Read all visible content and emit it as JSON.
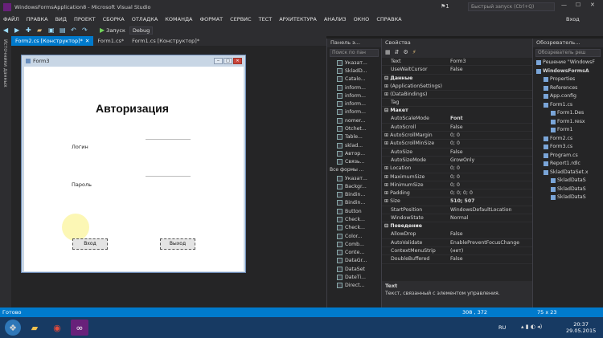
{
  "window": {
    "title": "WindowsFormsApplication8 - Microsoft Visual Studio",
    "quicklaunch_placeholder": "Быстрый запуск (Ctrl+Q)",
    "notif_count": "1",
    "user": "Вход"
  },
  "menu": [
    "ФАЙЛ",
    "ПРАВКА",
    "ВИД",
    "ПРОЕКТ",
    "СБОРКА",
    "ОТЛАДКА",
    "КОМАНДА",
    "ФОРМАТ",
    "СЕРВИС",
    "ТЕСТ",
    "АРХИТЕКТУРА",
    "АНАЛИЗ",
    "ОКНО",
    "СПРАВКА"
  ],
  "toolbar": {
    "run_label": "Запуск",
    "config": "Debug"
  },
  "left_tab": "Источники данных",
  "doc_tabs": [
    {
      "label": "Form2.cs [Конструктор]*",
      "active": true
    },
    {
      "label": "Form1.cs*",
      "active": false
    },
    {
      "label": "Form1.cs [Конструктор]*",
      "active": false
    }
  ],
  "form": {
    "title": "Form3",
    "heading": "Авторизация",
    "login_label": "Логин",
    "password_label": "Пароль",
    "enter_button": "Вход",
    "exit_button": "Выход"
  },
  "toolbox": {
    "title": "Панель э...",
    "search_placeholder": "Поиск по пан",
    "items_top": [
      "Указат...",
      "SkladD...",
      "Catalo...",
      "inform...",
      "inform...",
      "inform...",
      "inform...",
      "nomer...",
      "Otchet...",
      "Table...",
      "sklad...",
      "Автор...",
      "Связь..."
    ],
    "section": "Все формы ...",
    "items_bottom": [
      "Указат...",
      "Backgr...",
      "Bindin...",
      "Bindin...",
      "Button",
      "Check...",
      "Check...",
      "Color...",
      "Comb...",
      "Conte...",
      "DataGr...",
      "DataSet",
      "DateTi...",
      "Direct..."
    ]
  },
  "properties": {
    "title": "Свойства",
    "rows": [
      {
        "type": "prop",
        "k": "Text",
        "v": "Form3",
        "bold": false
      },
      {
        "type": "prop",
        "k": "UseWaitCursor",
        "v": "False",
        "bold": false
      },
      {
        "type": "cat",
        "k": "Данные"
      },
      {
        "type": "prop",
        "k": "(ApplicationSettings)",
        "v": "",
        "bold": false,
        "exp": true
      },
      {
        "type": "prop",
        "k": "(DataBindings)",
        "v": "",
        "bold": false,
        "exp": true
      },
      {
        "type": "prop",
        "k": "Tag",
        "v": "",
        "bold": false
      },
      {
        "type": "cat",
        "k": "Макет"
      },
      {
        "type": "prop",
        "k": "AutoScaleMode",
        "v": "Font",
        "bold": true
      },
      {
        "type": "prop",
        "k": "AutoScroll",
        "v": "False",
        "bold": false
      },
      {
        "type": "prop",
        "k": "AutoScrollMargin",
        "v": "0; 0",
        "bold": false,
        "exp": true
      },
      {
        "type": "prop",
        "k": "AutoScrollMinSize",
        "v": "0; 0",
        "bold": false,
        "exp": true
      },
      {
        "type": "prop",
        "k": "AutoSize",
        "v": "False",
        "bold": false
      },
      {
        "type": "prop",
        "k": "AutoSizeMode",
        "v": "GrowOnly",
        "bold": false
      },
      {
        "type": "prop",
        "k": "Location",
        "v": "0; 0",
        "bold": false,
        "exp": true
      },
      {
        "type": "prop",
        "k": "MaximumSize",
        "v": "0; 0",
        "bold": false,
        "exp": true
      },
      {
        "type": "prop",
        "k": "MinimumSize",
        "v": "0; 0",
        "bold": false,
        "exp": true
      },
      {
        "type": "prop",
        "k": "Padding",
        "v": "0; 0; 0; 0",
        "bold": false,
        "exp": true
      },
      {
        "type": "prop",
        "k": "Size",
        "v": "510; 507",
        "bold": true,
        "exp": true
      },
      {
        "type": "prop",
        "k": "StartPosition",
        "v": "WindowsDefaultLocation",
        "bold": false
      },
      {
        "type": "prop",
        "k": "WindowState",
        "v": "Normal",
        "bold": false
      },
      {
        "type": "cat",
        "k": "Поведение"
      },
      {
        "type": "prop",
        "k": "AllowDrop",
        "v": "False",
        "bold": false
      },
      {
        "type": "prop",
        "k": "AutoValidate",
        "v": "EnablePreventFocusChange",
        "bold": false
      },
      {
        "type": "prop",
        "k": "ContextMenuStrip",
        "v": "(нет)",
        "bold": false
      },
      {
        "type": "prop",
        "k": "DoubleBuffered",
        "v": "False",
        "bold": false
      }
    ],
    "desc_title": "Text",
    "desc_text": "Текст, связанный с элементом управления."
  },
  "solution": {
    "title": "Обозреватель...",
    "search_placeholder": "Обозреватель реш",
    "items": [
      {
        "t": "Решение \"WindowsF",
        "lvl": 0
      },
      {
        "t": "WindowsFormsA",
        "lvl": 0,
        "bold": true
      },
      {
        "t": "Properties",
        "lvl": 1
      },
      {
        "t": "References",
        "lvl": 1
      },
      {
        "t": "App.config",
        "lvl": 1
      },
      {
        "t": "Form1.cs",
        "lvl": 1
      },
      {
        "t": "Form1.Des",
        "lvl": 2
      },
      {
        "t": "Form1.resx",
        "lvl": 2
      },
      {
        "t": "Form1",
        "lvl": 2
      },
      {
        "t": "Form2.cs",
        "lvl": 1
      },
      {
        "t": "Form3.cs",
        "lvl": 1
      },
      {
        "t": "Program.cs",
        "lvl": 1
      },
      {
        "t": "Report1.rdlc",
        "lvl": 1
      },
      {
        "t": "SkladDataSet.x",
        "lvl": 1
      },
      {
        "t": "SkladDataS",
        "lvl": 2
      },
      {
        "t": "SkladDataS",
        "lvl": 2
      },
      {
        "t": "SkladDataS",
        "lvl": 2
      }
    ]
  },
  "status": {
    "text": "Готово",
    "pos": "308 , 372",
    "size": "75 x 23"
  },
  "taskbar": {
    "lang": "RU",
    "time": "20:37",
    "date": "29.05.2015"
  }
}
